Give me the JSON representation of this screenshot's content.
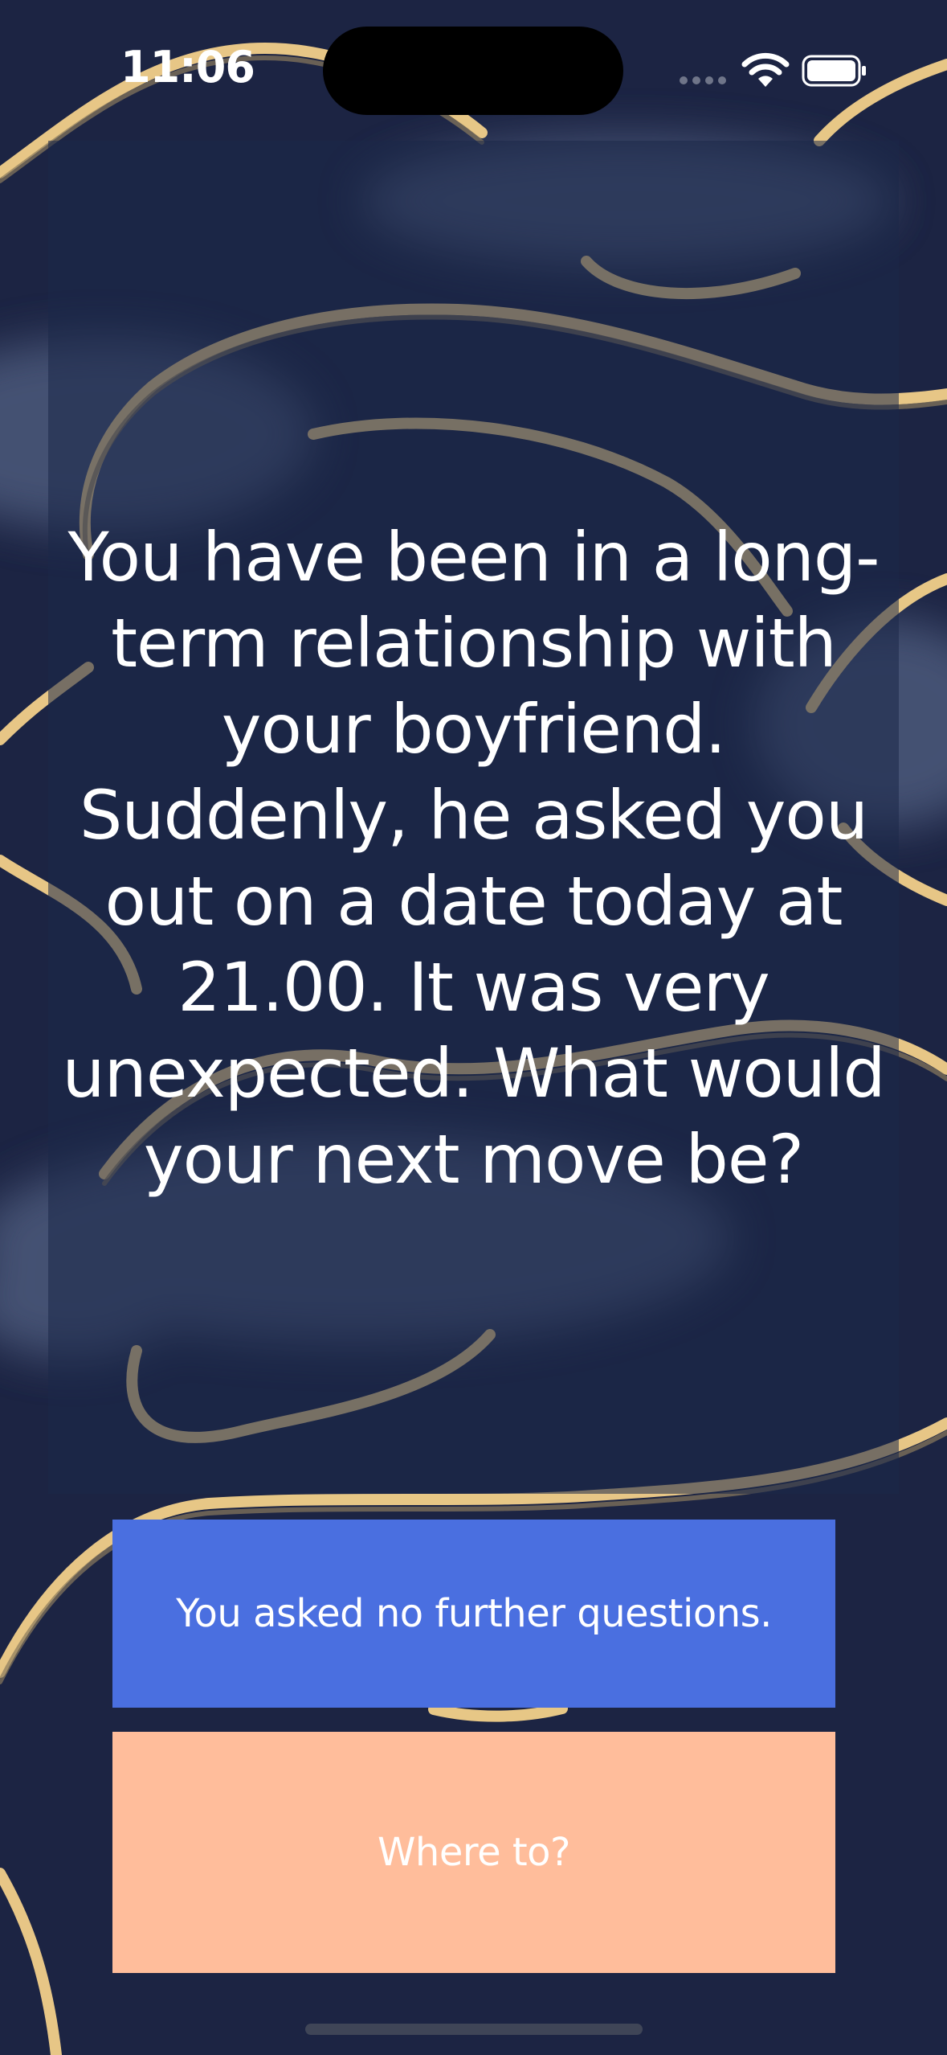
{
  "status_bar": {
    "time": "11:06",
    "icons": [
      "cellular-signal-icon",
      "wifi-icon",
      "battery-icon"
    ]
  },
  "scenario": {
    "question": "You have been in a long-term relationship with your boyfriend. Suddenly, he asked you out on a date today at 21.00. It was very unexpected. What would your next move be?"
  },
  "answers": [
    {
      "label": "You asked no further questions.",
      "color": "#4a6fe0"
    },
    {
      "label": "Where to?",
      "color": "#ffbd9b"
    }
  ],
  "colors": {
    "background": "#1c2443",
    "line_art": "#f2d08a",
    "cloud": "#4a5678"
  }
}
